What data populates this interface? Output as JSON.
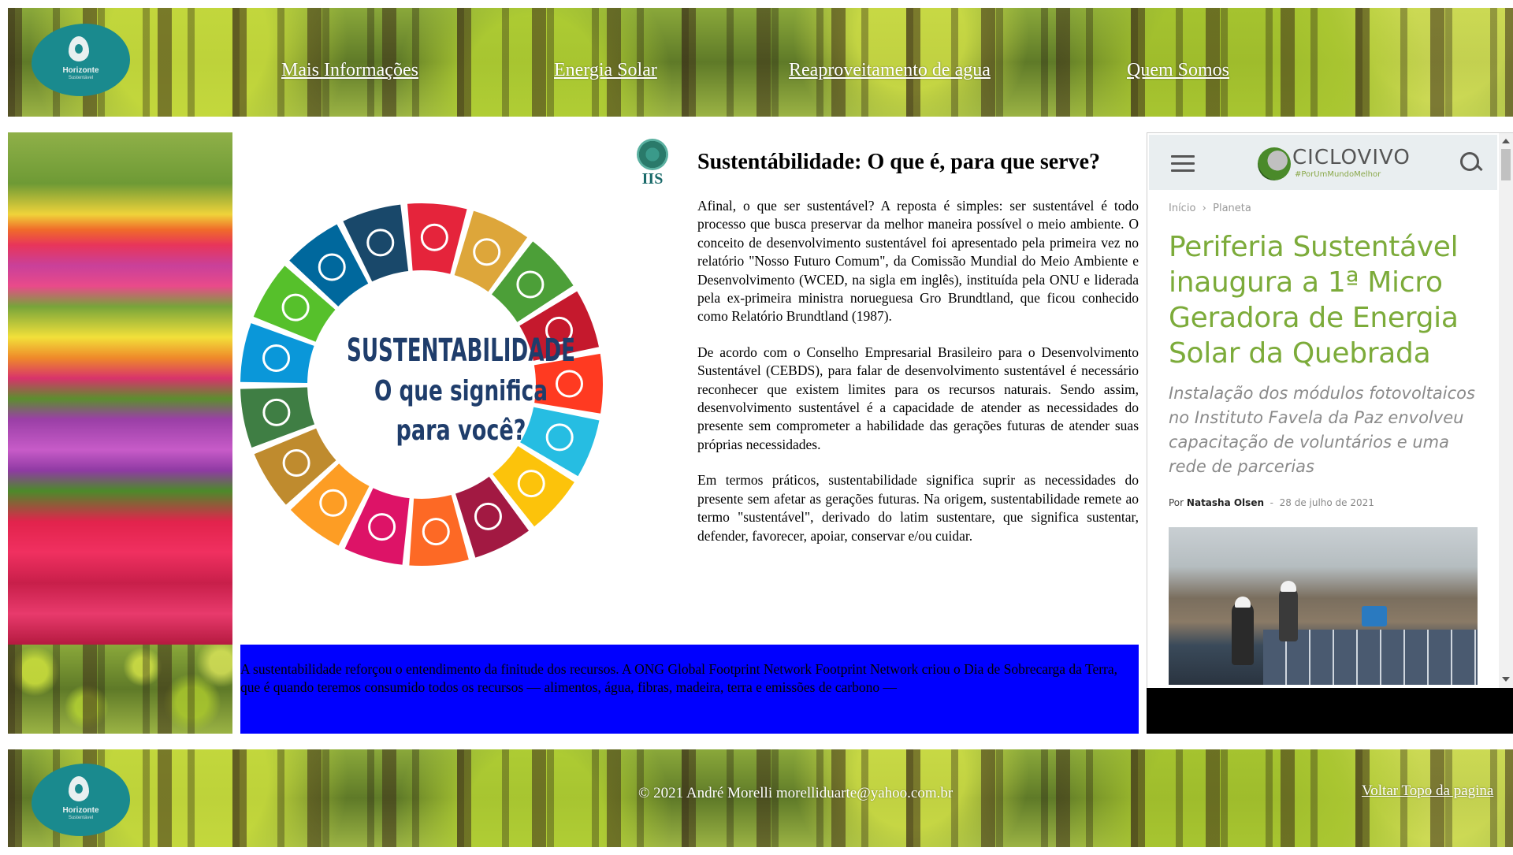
{
  "header": {
    "logo_name": "Horizonte",
    "logo_sub": "Sustentável",
    "nav": [
      {
        "label": "Mais Informações"
      },
      {
        "label": "Energia Solar"
      },
      {
        "label": "Reaproveitamento de agua"
      },
      {
        "label": "Quem Somos"
      }
    ]
  },
  "image": {
    "heading_line1": "SUSTENTABILIDADE",
    "heading_line2": "O que significa",
    "heading_line3": "para você?",
    "org_label": "IIS"
  },
  "article": {
    "title": "Sustentábilidade: O que é, para que serve?",
    "paragraphs": [
      "Afinal, o que ser sustentável? A reposta é simples: ser sustentável é todo processo que busca preservar da melhor maneira possível o meio ambiente. O conceito de desenvolvimento sustentável foi apresentado pela primeira vez no relatório \"Nosso Futuro Comum\", da Comissão Mundial do Meio Ambiente e Desenvolvimento (WCED, na sigla em inglês), instituída pela ONU e liderada pela ex-primeira ministra norueguesa Gro Brundtland, que ficou conhecido como Relatório Brundtland (1987).",
      "De acordo com o Conselho Empresarial Brasileiro para o Desenvolvimento Sustentável (CEBDS), para falar de desenvolvimento sustentável é necessário reconhecer que existem limites para os recursos naturais. Sendo assim, desenvolvimento sustentável é a capacidade de atender as necessidades do presente sem comprometer a habilidade das gerações futuras de atender suas próprias necessidades.",
      "Em termos práticos, sustentabilidade significa suprir as necessidades do presente sem afetar as gerações futuras. Na origem, sustentabilidade remete ao termo \"sustentável\", derivado do latim sustentare, que significa sustentar, defender, favorecer, apoiar, conservar e/ou cuidar."
    ],
    "blue_box_text": "A sustentabilidade reforçou o entendimento da finitude dos recursos. A ONG Global Footprint Network Footprint Network criou o Dia de Sobrecarga da Terra, que é quando teremos consumido todos os recursos — alimentos, água, fibras, madeira, terra e emissões de carbono —"
  },
  "widget": {
    "brand": "CICLOVIVO",
    "tagline": "#PorUmMundoMelhor",
    "breadcrumb_home": "Início",
    "breadcrumb_sep": "›",
    "breadcrumb_section": "Planeta",
    "title": "Periferia Sustentável inaugura a 1ª Micro Geradora de Energia Solar da Quebrada",
    "excerpt": "Instalação dos módulos fotovoltaicos no Instituto Favela da Paz envolveu capacitação de voluntários e uma rede de parcerias",
    "by_label": "Por",
    "author": "Natasha Olsen",
    "date_sep": "-",
    "date": "28 de julho de 2021"
  },
  "footer": {
    "copyright": "© 2021 André Morelli morelliduarte@yahoo.com.br",
    "back_to_top": "Voltar Topo da pagina"
  },
  "colors": {
    "blue_box": "#0000ff",
    "ciclovivo_green": "#7cab3a",
    "logo_teal": "#1a8a8e"
  },
  "sdg_colors": [
    "#e5243b",
    "#dda63a",
    "#4c9f38",
    "#c5192d",
    "#ff3a21",
    "#26bde2",
    "#fcc30b",
    "#a21942",
    "#fd6925",
    "#dd1367",
    "#fd9d24",
    "#bf8b2e",
    "#3f7e44",
    "#0a97d9",
    "#56c02b",
    "#00689d",
    "#19486a"
  ]
}
